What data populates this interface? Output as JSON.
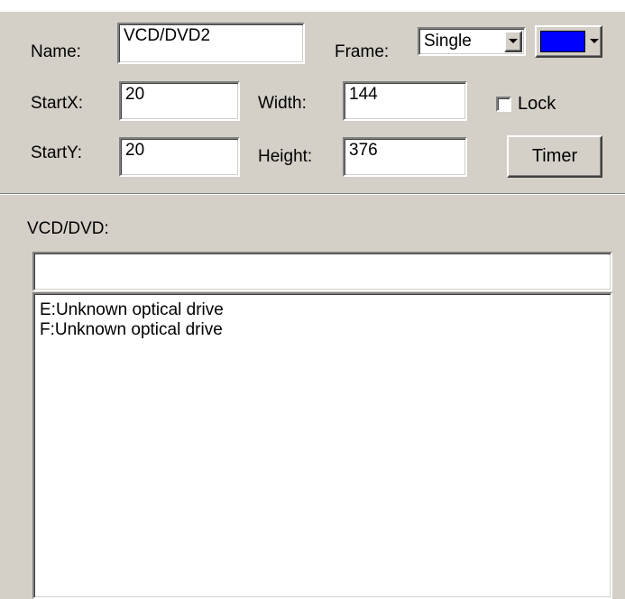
{
  "form": {
    "name_label": "Name:",
    "name_value": "VCD/DVD2",
    "frame_label": "Frame:",
    "frame_value": "Single",
    "color_value": "#0000ff",
    "startx_label": "StartX:",
    "startx_value": "20",
    "width_label": "Width:",
    "width_value": "144",
    "lock_label": "Lock",
    "lock_checked": false,
    "starty_label": "StartY:",
    "starty_value": "20",
    "height_label": "Height:",
    "height_value": "376",
    "timer_label": "Timer"
  },
  "drives": {
    "section_label": "VCD/DVD:",
    "input_value": "",
    "items": [
      {
        "label": "E:Unknown optical drive"
      },
      {
        "label": "F:Unknown optical drive"
      }
    ]
  }
}
